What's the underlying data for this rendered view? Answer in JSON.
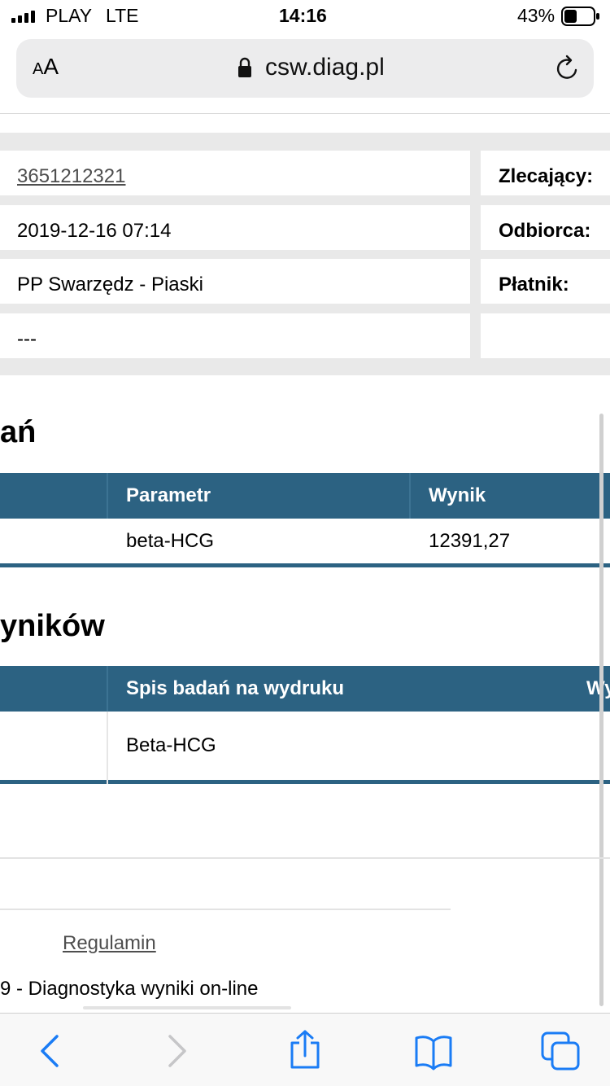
{
  "status_bar": {
    "carrier": "PLAY",
    "network": "LTE",
    "time": "14:16",
    "battery": "43%",
    "battery_level": 0.43
  },
  "browser": {
    "text_size_button": "AA",
    "url": "csw.diag.pl",
    "icons": [
      "lock-icon",
      "reload-icon"
    ]
  },
  "info_table": {
    "rows": [
      {
        "value": "3651212321",
        "label": "Zlecający:"
      },
      {
        "value": "2019-12-16 07:14",
        "label": "Odbiorca:"
      },
      {
        "value": "PP Swarzędz - Piaski",
        "label": "Płatnik:"
      },
      {
        "value": "---",
        "label": ""
      }
    ]
  },
  "results": {
    "heading": "ań",
    "columns": [
      "Parametr",
      "Wynik"
    ],
    "rows": [
      {
        "param": "beta-HCG",
        "value": "12391,27"
      }
    ]
  },
  "prints": {
    "heading": "yników",
    "columns": [
      "Spis badań na wydruku",
      "Wy"
    ],
    "rows": [
      {
        "name": "Beta-HCG"
      }
    ]
  },
  "footer": {
    "terms_link": "Regulamin",
    "copyright": "9 - Diagnostyka wyniki on-line"
  },
  "toolbar": {
    "icons": [
      "back-icon",
      "forward-icon",
      "share-icon",
      "bookmarks-icon",
      "tabs-icon"
    ]
  },
  "colors": {
    "accent": "#2c6282",
    "ios_blue": "#1a7cf5"
  }
}
